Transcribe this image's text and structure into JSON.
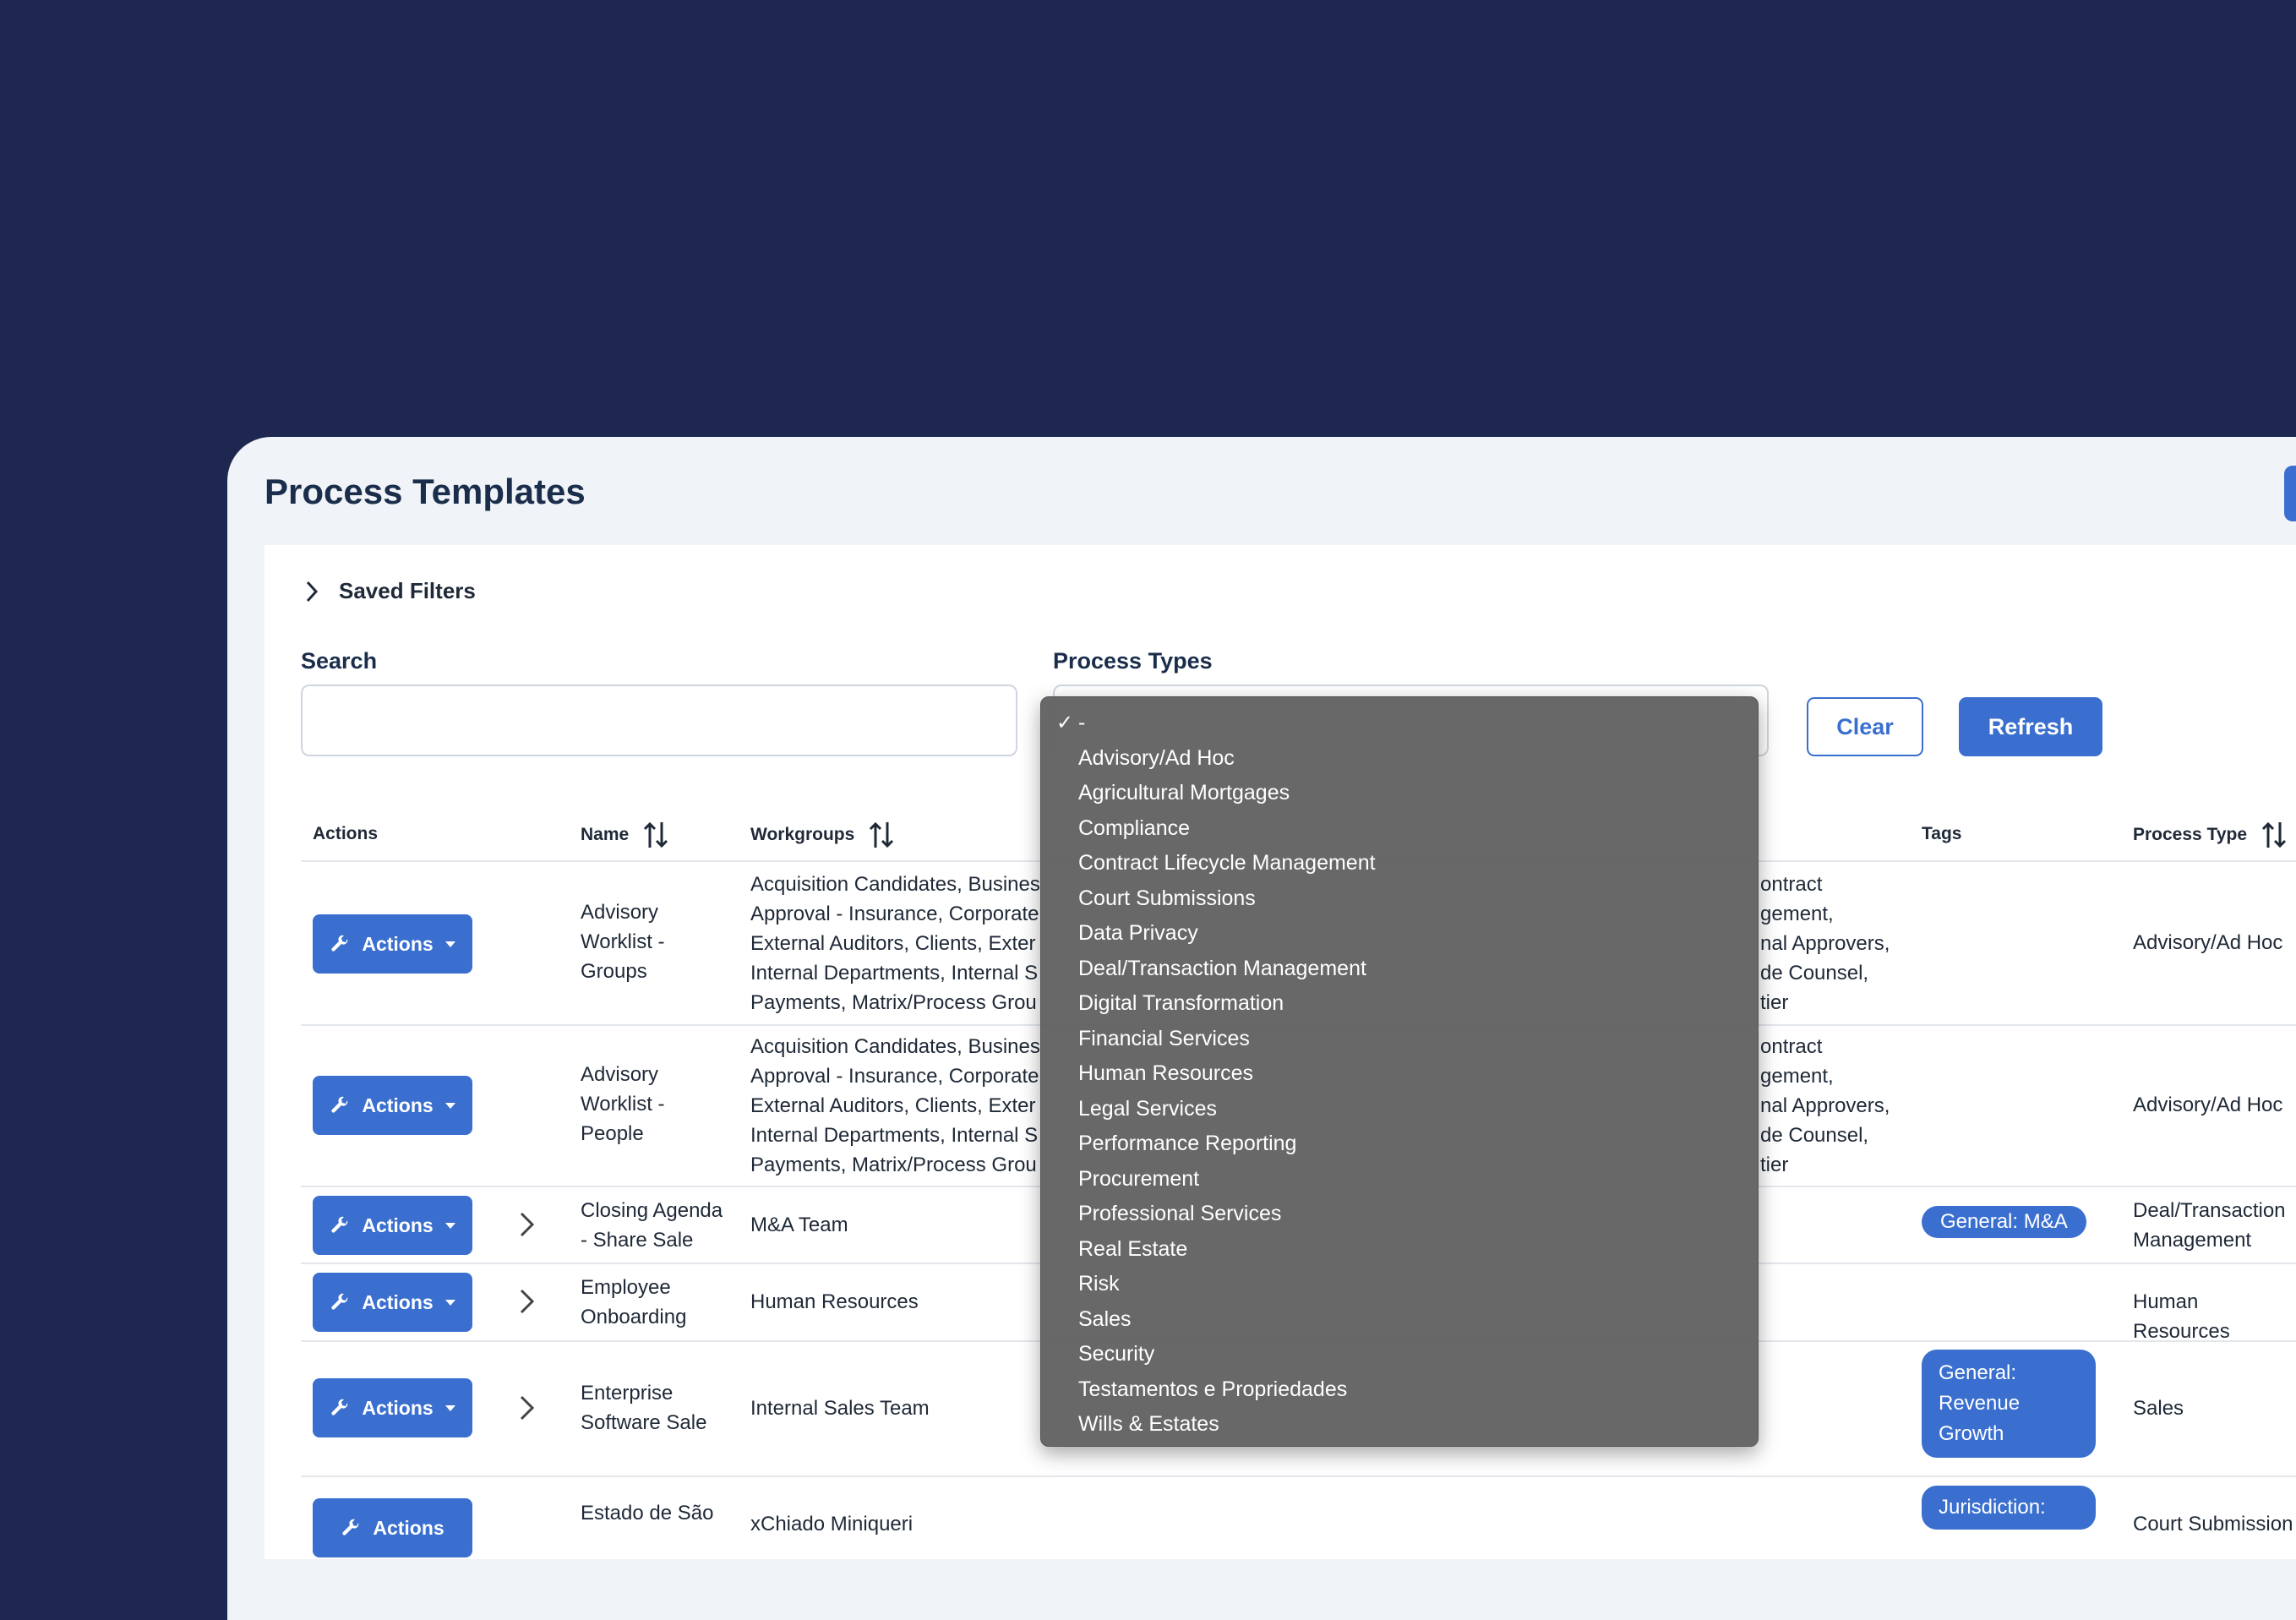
{
  "page": {
    "title": "Process Templates"
  },
  "filters": {
    "saved_filters_label": "Saved Filters",
    "search_label": "Search",
    "search_value": "",
    "process_types_label": "Process Types",
    "clear_label": "Clear",
    "refresh_label": "Refresh"
  },
  "table": {
    "headers": {
      "actions": "Actions",
      "name": "Name",
      "workgroups": "Workgroups",
      "tags": "Tags",
      "process_type": "Process Type"
    },
    "rows": [
      {
        "action": "Actions",
        "name": [
          "Advisory",
          "Worklist -",
          "Groups"
        ],
        "workgroups": [
          "Acquisition Candidates, Busines",
          "Approval - Insurance, Corporate",
          "External Auditors, Clients, Exter",
          "Internal Departments, Internal S",
          "Payments, Matrix/Process Grou"
        ],
        "workgroups_right": [
          "ontract",
          "gement,",
          "nal Approvers,",
          "de Counsel,",
          "tier"
        ],
        "tag": "",
        "process_type": [
          "Advisory/Ad Hoc"
        ]
      },
      {
        "action": "Actions",
        "name": [
          "Advisory",
          "Worklist -",
          "People"
        ],
        "workgroups": [
          "Acquisition Candidates, Busines",
          "Approval - Insurance, Corporate",
          "External Auditors, Clients, Exter",
          "Internal Departments, Internal S",
          "Payments, Matrix/Process Grou"
        ],
        "workgroups_right": [
          "ontract",
          "gement,",
          "nal Approvers,",
          "de Counsel,",
          "tier"
        ],
        "tag": "",
        "process_type": [
          "Advisory/Ad Hoc"
        ]
      },
      {
        "action": "Actions",
        "name": [
          "Closing Agenda",
          "- Share Sale"
        ],
        "workgroups": [
          "M&A Team"
        ],
        "tag": "General: M&A",
        "process_type": [
          "Deal/Transaction",
          "Management"
        ]
      },
      {
        "action": "Actions",
        "name": [
          "Employee",
          "Onboarding"
        ],
        "workgroups": [
          "Human Resources"
        ],
        "tag": "",
        "process_type": [
          "Human Resources"
        ]
      },
      {
        "action": "Actions",
        "name": [
          "Enterprise",
          "Software Sale"
        ],
        "workgroups": [
          "Internal Sales Team"
        ],
        "tag": [
          "General:",
          "Revenue",
          "Growth"
        ],
        "process_type": [
          "Sales"
        ]
      },
      {
        "action": "Actions",
        "name": [
          "Estado de São"
        ],
        "workgroups": [
          "xChiado Miniqueri"
        ],
        "tag": [
          "Jurisdiction:"
        ],
        "process_type": [
          "Court Submission"
        ]
      }
    ]
  },
  "process_type_options": {
    "selected": "-",
    "items": [
      "-",
      "Advisory/Ad Hoc",
      "Agricultural Mortgages",
      "Compliance",
      "Contract Lifecycle Management",
      "Court Submissions",
      "Data Privacy",
      "Deal/Transaction Management",
      "Digital Transformation",
      "Financial Services",
      "Human Resources",
      "Legal Services",
      "Performance Reporting",
      "Procurement",
      "Professional Services",
      "Real Estate",
      "Risk",
      "Sales",
      "Security",
      "Testamentos e Propriedades",
      "Wills & Estates"
    ]
  },
  "colors": {
    "background": "#1e2750",
    "accent": "#3a6fcf",
    "card": "#f0f3f7"
  }
}
